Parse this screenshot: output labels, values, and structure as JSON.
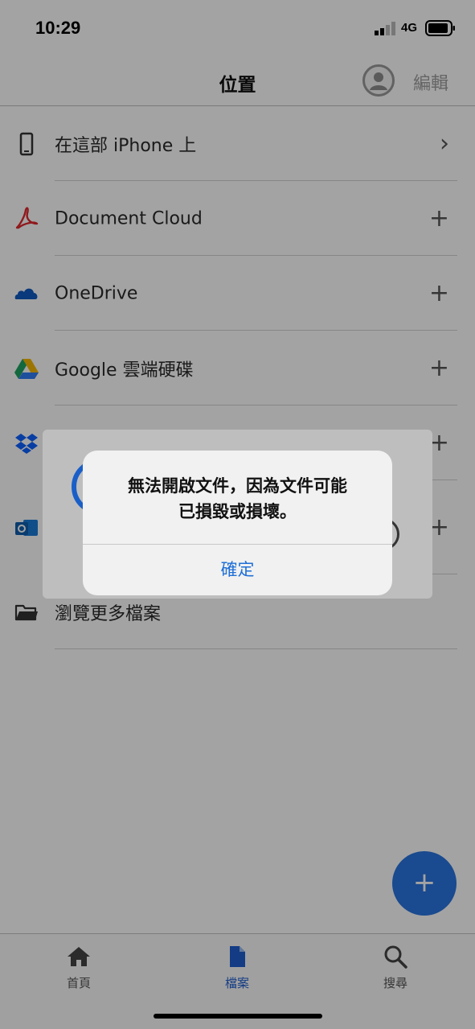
{
  "status_bar": {
    "time": "10:29",
    "network": "4G"
  },
  "nav": {
    "title": "位置",
    "edit_label": "編輯"
  },
  "locations": [
    {
      "label": "在這部 iPhone 上",
      "action": "›",
      "icon": "phone-icon"
    },
    {
      "label": "Document Cloud",
      "action": "+",
      "icon": "acrobat-icon"
    },
    {
      "label": "OneDrive",
      "action": "+",
      "icon": "onedrive-icon"
    },
    {
      "label": "Google 雲端硬碟",
      "action": "+",
      "icon": "google-drive-icon"
    },
    {
      "label": "",
      "action": "+",
      "icon": "dropbox-icon"
    },
    {
      "label": "",
      "action": "+",
      "icon": "outlook-icon"
    },
    {
      "label": "瀏覽更多檔案",
      "action": "",
      "icon": "folder-icon"
    }
  ],
  "fab": {
    "label": "+"
  },
  "tabs": [
    {
      "label": "首頁",
      "icon": "home-icon",
      "active": false
    },
    {
      "label": "檔案",
      "icon": "document-icon",
      "active": true
    },
    {
      "label": "搜尋",
      "icon": "search-icon",
      "active": false
    }
  ],
  "alert": {
    "message_line1": "無法開啟文件，因為文件可能",
    "message_line2": "已損毀或損壞。",
    "confirm_label": "確定"
  },
  "colors": {
    "accent": "#2a74e0",
    "tab_active": "#1f5fcf",
    "alert_button": "#1f6fd6",
    "acrobat_red": "#e0282e",
    "onedrive_blue": "#1159c2",
    "dropbox_blue": "#0d62ff"
  }
}
